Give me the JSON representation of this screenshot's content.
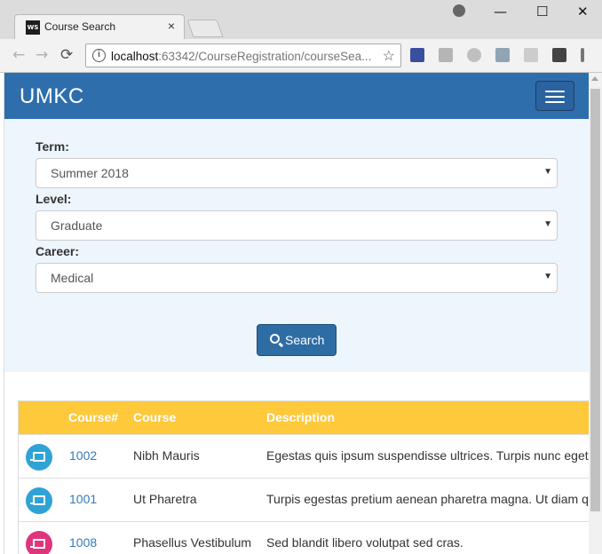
{
  "browser": {
    "tab_title": "Course Search",
    "favicon_text": "WS",
    "url_host": "localhost",
    "url_rest": ":63342/CourseRegistration/courseSea..."
  },
  "navbar": {
    "brand": "UMKC"
  },
  "form": {
    "term_label": "Term:",
    "term_value": "Summer 2018",
    "level_label": "Level:",
    "level_value": "Graduate",
    "career_label": "Career:",
    "career_value": "Medical",
    "search_button": "Search"
  },
  "table": {
    "headers": [
      "Course#",
      "Course",
      "Description"
    ],
    "rows": [
      {
        "course_no": "1002",
        "course": "Nibh Mauris",
        "description": "Egestas quis ipsum suspendisse ultrices. Turpis nunc eget lorem dolor sed",
        "icon_color": "#2fa3d6",
        "icon": "presentation-icon"
      },
      {
        "course_no": "1001",
        "course": "Ut Pharetra",
        "description": "Turpis egestas pretium aenean pharetra magna. Ut diam quam nulla porttitor",
        "icon_color": "#2fa3d6",
        "icon": "presentation-icon"
      },
      {
        "course_no": "1008",
        "course": "Phasellus Vestibulum",
        "description": "Sed blandit libero volutpat sed cras.",
        "icon_color": "#e0357c",
        "icon": "pink-course-icon"
      }
    ]
  },
  "colors": {
    "navbar": "#2f6ead",
    "form_bg": "#edf5fd",
    "table_header": "#ffc93c",
    "button": "#2e6da4",
    "link": "#337ab7"
  }
}
